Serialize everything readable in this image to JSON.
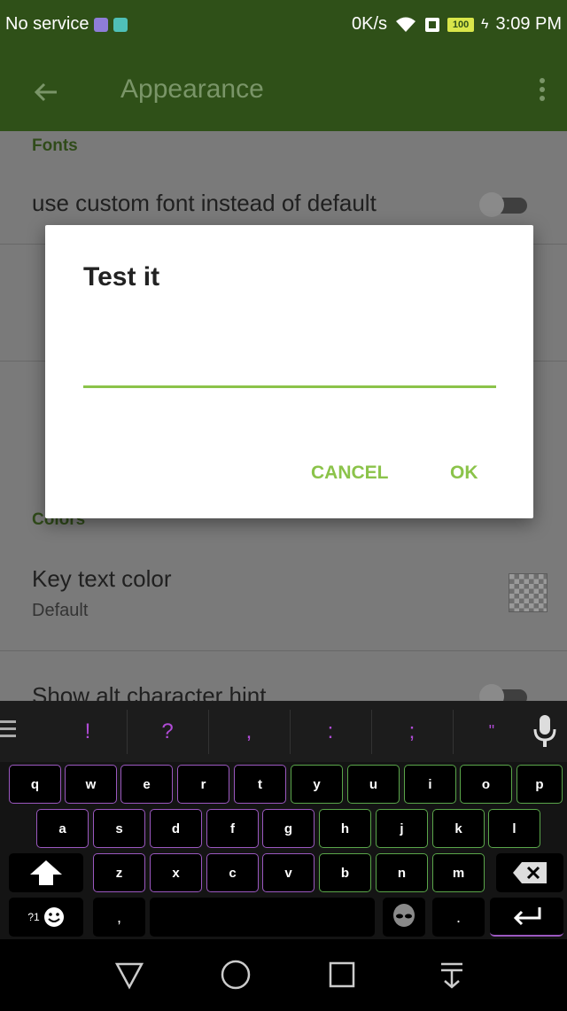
{
  "status_bar": {
    "carrier": "No service",
    "network_speed": "0K/s",
    "battery_level": "100",
    "time": "3:09 PM"
  },
  "toolbar": {
    "title": "Appearance"
  },
  "settings": {
    "fonts_header": "Fonts",
    "custom_font_label": "use custom font instead of default",
    "colors_header": "Colors",
    "key_text_color_label": "Key text color",
    "key_text_color_value": "Default",
    "alt_hint_label": "Show alt character hint"
  },
  "dialog": {
    "title": "Test it",
    "input_value": "",
    "cancel_label": "CANCEL",
    "ok_label": "OK",
    "accent_color": "#8bc34a"
  },
  "keyboard": {
    "suggestions": [
      "!",
      "?",
      ",",
      ":",
      ";",
      "\""
    ],
    "row1": [
      "q",
      "w",
      "e",
      "r",
      "t",
      "y",
      "u",
      "i",
      "o",
      "p"
    ],
    "row2": [
      "a",
      "s",
      "d",
      "f",
      "g",
      "h",
      "j",
      "k",
      "l"
    ],
    "row3": [
      "z",
      "x",
      "c",
      "v",
      "b",
      "n",
      "m"
    ],
    "symbols_label": "?1",
    "comma_label": ",",
    "period_label": "."
  },
  "colors": {
    "toolbar": "#2f5018",
    "key_border_purple": "#9b58c0",
    "key_border_green": "#5aa64a",
    "suggestion_text": "#b04bd6"
  }
}
